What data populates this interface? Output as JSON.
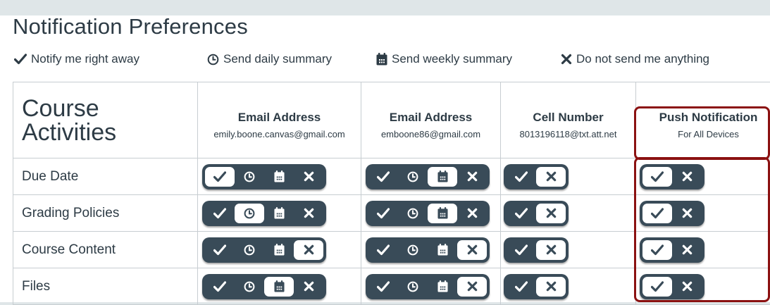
{
  "page": {
    "title": "Notification Preferences"
  },
  "legend": [
    {
      "icon": "check-icon",
      "label": "Notify me right away"
    },
    {
      "icon": "clock-icon",
      "label": "Send daily summary"
    },
    {
      "icon": "calendar-icon",
      "label": "Send weekly summary"
    },
    {
      "icon": "x-icon",
      "label": "Do not send me anything"
    }
  ],
  "table": {
    "category_title": "Course Activities",
    "channels": [
      {
        "label": "Email Address",
        "address": "emily.boone.canvas@gmail.com",
        "options": [
          "immediately",
          "daily",
          "weekly",
          "never"
        ]
      },
      {
        "label": "Email Address",
        "address": "emboone86@gmail.com",
        "options": [
          "immediately",
          "daily",
          "weekly",
          "never"
        ]
      },
      {
        "label": "Cell Number",
        "address": "8013196118@txt.att.net",
        "options": [
          "immediately",
          "never"
        ]
      },
      {
        "label": "Push Notification",
        "address": "For All Devices",
        "options": [
          "immediately",
          "never"
        ]
      }
    ],
    "rows": [
      {
        "label": "Due Date",
        "selected": [
          "immediately",
          "weekly",
          "never",
          "immediately"
        ]
      },
      {
        "label": "Grading Policies",
        "selected": [
          "daily",
          "weekly",
          "never",
          "immediately"
        ]
      },
      {
        "label": "Course Content",
        "selected": [
          "never",
          "never",
          "never",
          "immediately"
        ]
      },
      {
        "label": "Files",
        "selected": [
          "weekly",
          "never",
          "never",
          "immediately"
        ]
      }
    ]
  },
  "colors": {
    "pill_bg": "#394b58",
    "selected_bg": "#ffffff",
    "highlight_border": "#8b1111",
    "text": "#2d3b45"
  }
}
